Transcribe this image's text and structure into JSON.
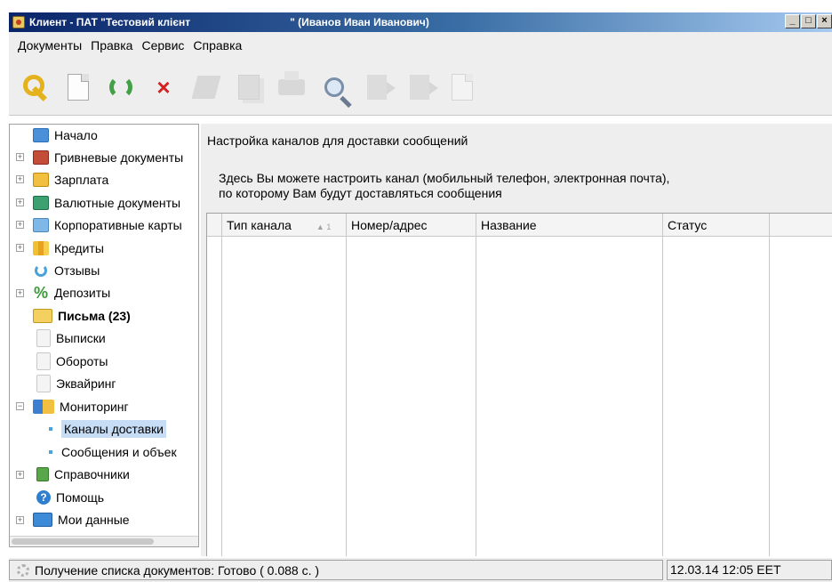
{
  "window": {
    "title_part1": "Клиент - ПАТ \"Тестовий клієнт",
    "title_part2": "\" (Иванов Иван Иванович)",
    "minimize": "_",
    "maximize": "□",
    "close": "×"
  },
  "menu": [
    "Документы",
    "Правка",
    "Сервис",
    "Справка"
  ],
  "toolbar": [
    {
      "icon": "key-icon",
      "enabled": true
    },
    {
      "icon": "new-document-icon",
      "enabled": true
    },
    {
      "icon": "refresh-icon",
      "enabled": true
    },
    {
      "icon": "delete-icon",
      "enabled": true
    },
    {
      "icon": "edit-icon",
      "enabled": false
    },
    {
      "icon": "copy-icon",
      "enabled": false
    },
    {
      "icon": "print-icon",
      "enabled": false
    },
    {
      "icon": "search-icon",
      "enabled": true
    },
    {
      "icon": "import-icon",
      "enabled": false
    },
    {
      "icon": "export-icon",
      "enabled": false
    },
    {
      "icon": "document-icon",
      "enabled": false
    }
  ],
  "tree": [
    {
      "label": "Начало",
      "icon": "home-monitor-icon"
    },
    {
      "label": "Гривневые документы",
      "icon": "uah-documents-icon"
    },
    {
      "label": "Зарплата",
      "icon": "salary-folder-icon"
    },
    {
      "label": "Валютные документы",
      "icon": "currency-documents-icon"
    },
    {
      "label": "Корпоративные карты",
      "icon": "corporate-card-icon"
    },
    {
      "label": "Кредиты",
      "icon": "credits-icon"
    },
    {
      "label": "Отзывы",
      "icon": "feedback-icon"
    },
    {
      "label": "Депозиты",
      "icon": "percent-icon"
    },
    {
      "label": "Письма (23)",
      "icon": "mail-icon"
    },
    {
      "label": "Выписки",
      "icon": "statement-icon"
    },
    {
      "label": "Обороты",
      "icon": "turnover-icon"
    },
    {
      "label": "Эквайринг",
      "icon": "acquiring-icon"
    },
    {
      "label": "Мониторинг",
      "icon": "monitoring-icon"
    },
    {
      "label": "Каналы доставки",
      "icon": "bullet-icon"
    },
    {
      "label": "Сообщения и объек",
      "icon": "bullet-icon"
    },
    {
      "label": "Справочники",
      "icon": "reference-book-icon"
    },
    {
      "label": "Помощь",
      "icon": "help-icon"
    },
    {
      "label": "Мои данные",
      "icon": "my-data-icon"
    }
  ],
  "main": {
    "title": "Настройка каналов для доставки сообщений",
    "description_line1": "Здесь Вы можете настроить канал (мобильный телефон, электронная почта),",
    "description_line2": "по которому Вам будут доставляться сообщения",
    "table": {
      "columns": [
        "Тип канала",
        "Номер/адрес",
        "Название",
        "Статус"
      ],
      "sort_indicator": "▲ 1",
      "rows": []
    }
  },
  "status": {
    "message": "Получение списка документов: Готово ( 0.088 с. )",
    "datetime": "12.03.14 12:05 EET"
  }
}
